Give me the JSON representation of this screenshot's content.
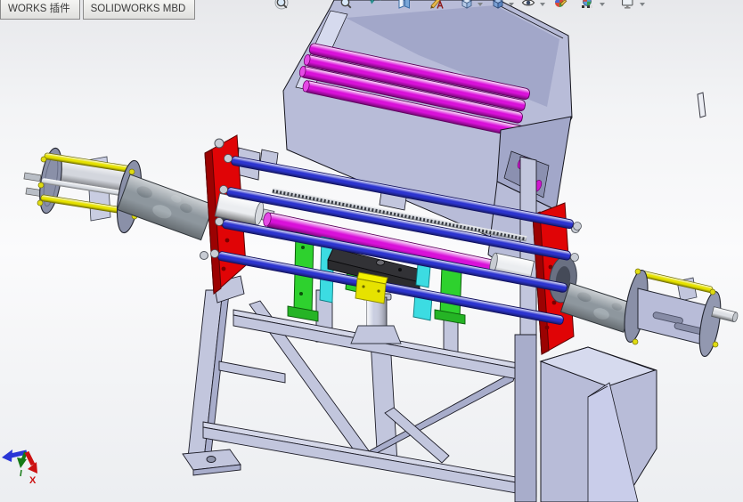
{
  "tabs": [
    {
      "label": "WORKS 插件"
    },
    {
      "label": "SOLIDWORKS MBD"
    }
  ],
  "toolbar": {
    "icons": [
      {
        "name": "zoom-to-fit"
      },
      {
        "name": "zoom-to-area"
      },
      {
        "name": "previous-view"
      },
      {
        "name": "section-view"
      },
      {
        "name": "annotation"
      },
      {
        "name": "view-orientation",
        "has_dropdown": true
      },
      {
        "name": "display-style",
        "has_dropdown": true
      },
      {
        "name": "hide-show-items",
        "has_dropdown": true
      },
      {
        "name": "edit-appearance"
      },
      {
        "name": "apply-scene",
        "has_dropdown": true
      },
      {
        "name": "view-settings",
        "has_dropdown": true
      }
    ]
  },
  "viewport": {
    "triad": {
      "x_label": "X"
    }
  },
  "colors": {
    "part_lavender": "#b8bcd8",
    "part_lavender_light": "#d6daee",
    "part_lavender_inner": "#a2a7c9",
    "frame_steel": "#c2c6dd",
    "frame_steel_dark": "#a8adcb",
    "roller_magenta": "#d911d9",
    "rod_blue": "#2c34cf",
    "plate_red": "#e00406",
    "plate_red_dark": "#9c0202",
    "part_green": "#2ed12e",
    "part_cyan": "#3cdce2",
    "part_yellow": "#e6e200",
    "shaft_gray": "#8e979e",
    "flange_gray": "#8a90a8",
    "coupling_white": "#ebedf0",
    "black_plate": "#2b2b2e",
    "triad_x": "#cc1111",
    "triad_y": "#157a15",
    "triad_z": "#2936d6"
  },
  "model": {
    "parts": [
      {
        "name": "feed-hopper",
        "color": "#b8bcd8"
      },
      {
        "name": "hopper-rollers",
        "count": 4,
        "color": "#d911d9"
      },
      {
        "name": "discharge-chute",
        "color": "#b8bcd8"
      },
      {
        "name": "support-frame",
        "color": "#c2c6dd"
      },
      {
        "name": "left-tension-cage",
        "color": "#e6e200"
      },
      {
        "name": "drive-shaft-left",
        "color": "#8e979e"
      },
      {
        "name": "mount-plate-left",
        "color": "#e00406"
      },
      {
        "name": "mount-plate-right",
        "color": "#e00406"
      },
      {
        "name": "guide-rods",
        "count": 4,
        "color": "#2c34cf"
      },
      {
        "name": "lead-screw",
        "color": "#3f434a"
      },
      {
        "name": "center-roller",
        "color": "#d911d9"
      },
      {
        "name": "carriage-plate",
        "color": "#2b2b2e"
      },
      {
        "name": "carriage-brackets",
        "color": "#2ed12e"
      },
      {
        "name": "carriage-shims",
        "color": "#3cdce2"
      },
      {
        "name": "rod-clamp",
        "color": "#e6e200"
      },
      {
        "name": "support-cylinder",
        "color": "#c9cde0"
      },
      {
        "name": "drive-shaft-right",
        "color": "#8e979e"
      },
      {
        "name": "slotted-drum",
        "color": "#b5b9d8"
      }
    ]
  }
}
